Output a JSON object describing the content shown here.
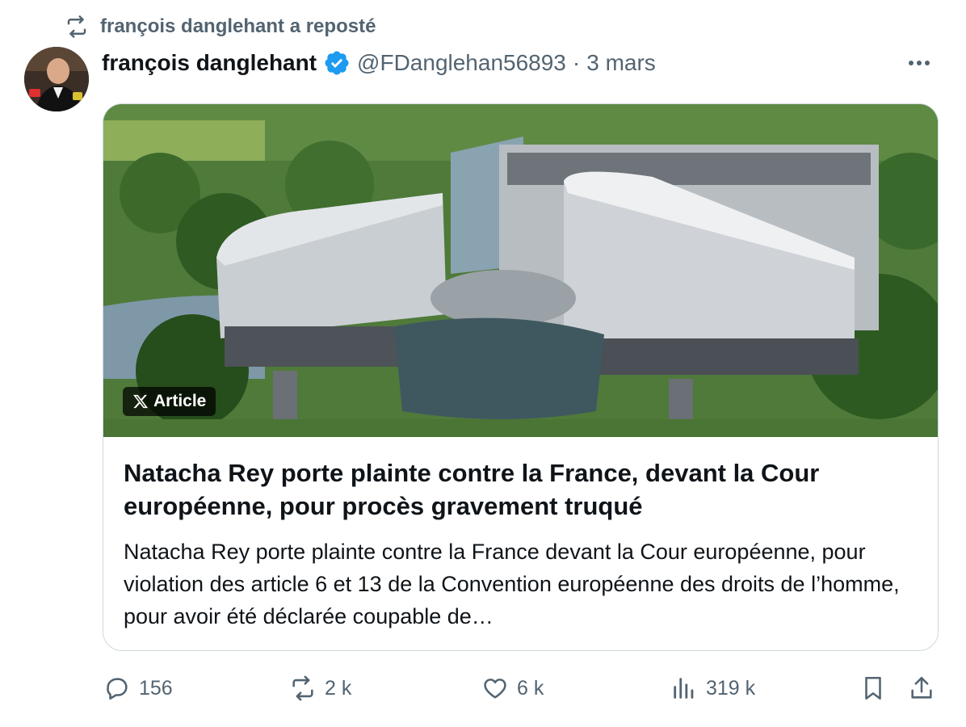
{
  "repost": {
    "text": "françois danglehant a reposté",
    "icon": "repost-icon"
  },
  "author": {
    "name": "françois danglehant",
    "handle": "@FDanglehan56893",
    "separator": "·",
    "date": "3 mars",
    "verified": true
  },
  "card": {
    "badge_label": "Article",
    "title": "Natacha Rey porte plainte contre la France, devant la Cour européenne, pour procès gravement truqué",
    "description": "Natacha Rey porte plainte contre la France devant la Cour européenne, pour violation des article 6 et 13 de la Convention européenne des droits de l’homme, pour avoir été déclarée coupable de…"
  },
  "actions": {
    "replies": "156",
    "reposts": "2 k",
    "likes": "6 k",
    "views": "319 k"
  },
  "colors": {
    "accent": "#1d9bf0",
    "secondary_text": "#536471",
    "border": "#cfd9de"
  }
}
